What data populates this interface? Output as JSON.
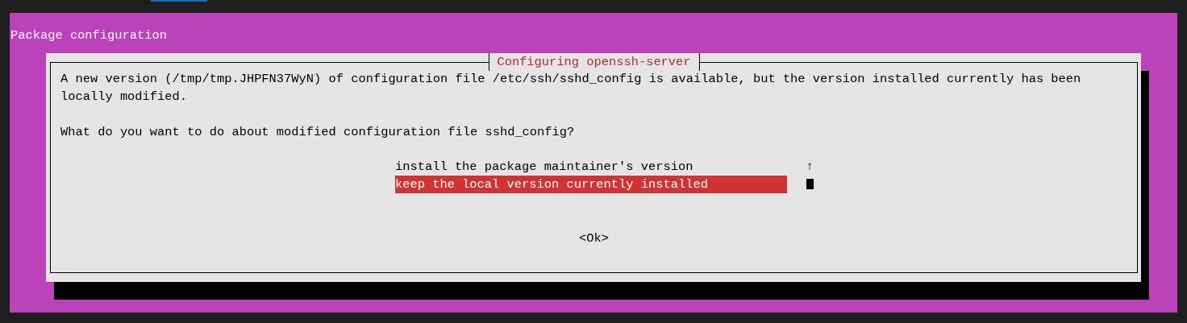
{
  "window": {
    "title": "Package configuration"
  },
  "dialog": {
    "title": "Configuring openssh-server",
    "message": "A new version (/tmp/tmp.JHPFN37WyN) of configuration file /etc/ssh/sshd_config is available, but the version installed currently has been locally modified.",
    "question": "What do you want to do about modified configuration file sshd_config?",
    "options": [
      {
        "label": "install the package maintainer's version",
        "selected": false
      },
      {
        "label": "keep the local version currently installed",
        "selected": true
      }
    ],
    "scroll_indicator": "↑",
    "buttons": [
      "<Ok>"
    ]
  }
}
